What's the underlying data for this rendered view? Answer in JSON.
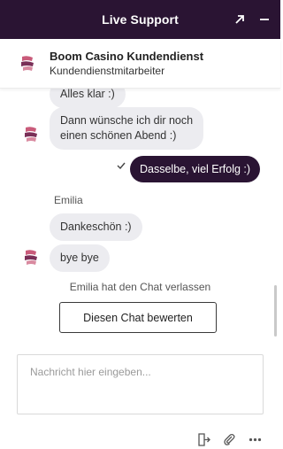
{
  "header": {
    "title": "Live Support",
    "icons": [
      "expand-icon",
      "minimize-icon"
    ],
    "background": "#2a1433"
  },
  "agent": {
    "name": "Boom Casino Kundendienst",
    "role": "Kundendienstmitarbeiter",
    "logo": "boom-casino-logo"
  },
  "messages": [
    {
      "from": "agent",
      "text": "Alles klar :)"
    },
    {
      "from": "agent",
      "line1": "Dann wünsche ich dir noch",
      "line2": "einen schönen Abend :)"
    },
    {
      "from": "user",
      "text": "Dasselbe, viel Erfolg :)",
      "status_icon": "check-icon"
    },
    {
      "from": "user_label",
      "text": "Emilia"
    },
    {
      "from": "agent",
      "text": "Dankeschön :)"
    },
    {
      "from": "agent",
      "text": "bye bye"
    }
  ],
  "system": {
    "left_chat": "Emilia hat den Chat verlassen",
    "rate_button": "Diesen Chat bewerten"
  },
  "composer": {
    "placeholder": "Nachricht hier eingeben...",
    "value": ""
  },
  "toolbar": {
    "icons": [
      "end-chat-icon",
      "attachment-icon",
      "more-options-icon"
    ]
  },
  "colors": {
    "brand_dark": "#2a1433",
    "bubble_incoming": "#ececf0",
    "text": "#333333"
  }
}
